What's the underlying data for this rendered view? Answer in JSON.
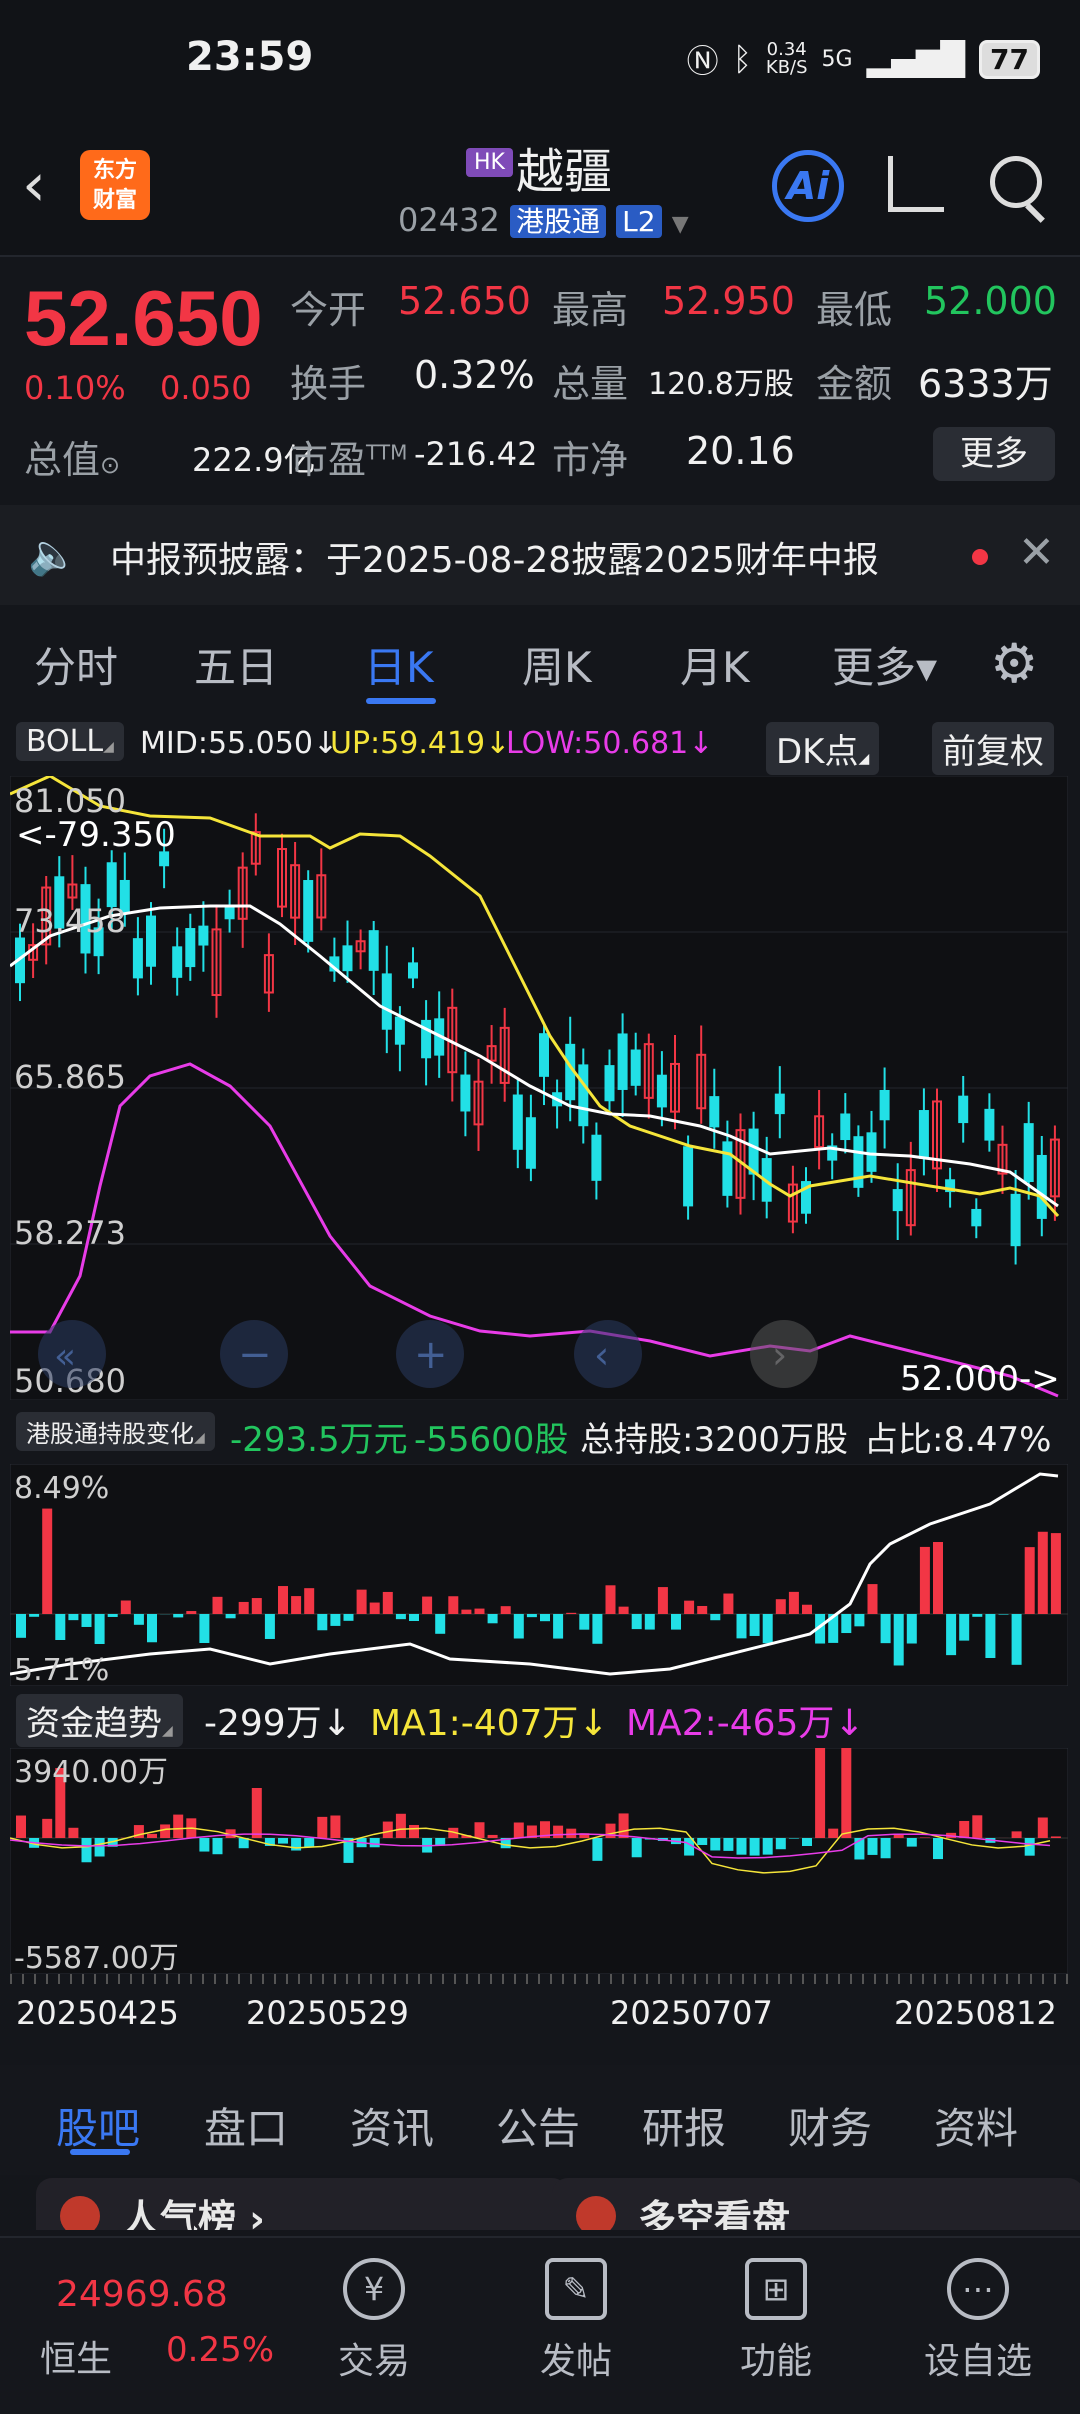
{
  "status_bar": {
    "time": "23:59",
    "net_speed": "0.34",
    "net_unit": "KB/S",
    "signal": "5G",
    "battery": "77"
  },
  "header": {
    "logo_line1": "东方",
    "logo_line2": "财富",
    "market_badge": "HK",
    "name": "越疆",
    "code": "02432",
    "connect_tag": "港股通",
    "level_tag": "L2",
    "ai_label": "Ai"
  },
  "quote": {
    "price": "52.650",
    "change_pct": "0.10%",
    "change_amt": "0.050",
    "open_label": "今开",
    "open": "52.650",
    "high_label": "最高",
    "high": "52.950",
    "low_label": "最低",
    "low": "52.000",
    "turnover_label": "换手",
    "turnover": "0.32%",
    "volume_label": "总量",
    "volume": "120.8万股",
    "amount_label": "金额",
    "amount": "6333万",
    "mcap_label": "总值",
    "mcap": "222.9亿",
    "pe_label": "市盈",
    "pe_sup": "TTM",
    "pe": "-216.42",
    "pb_label": "市净",
    "pb": "20.16",
    "more": "更多"
  },
  "notice": {
    "text": "中报预披露：于2025-08-28披露2025财年中报"
  },
  "ktabs": [
    "分时",
    "五日",
    "日K",
    "周K",
    "月K",
    "更多▾"
  ],
  "boll": {
    "name": "BOLL",
    "mid": "MID:55.050↓",
    "up": "UP:59.419↓",
    "low": "LOW:50.681↓",
    "dk": "DK点",
    "adj": "前复权"
  },
  "main_chart": {
    "y_labels": [
      "81.050",
      "73.458",
      "65.865",
      "58.273",
      "50.680"
    ],
    "max_marker": "<-79.350",
    "min_marker": "52.000->"
  },
  "hold": {
    "name": "港股通持股变化",
    "chg_amount": "-293.5万元",
    "chg_shares": "-55600股",
    "total": "总持股:3200万股",
    "ratio": "占比:8.47%",
    "y_top": "8.49%",
    "y_bottom": "5.71%"
  },
  "fund": {
    "name": "资金趋势",
    "value": "-299万↓",
    "ma1": "MA1:-407万↓",
    "ma2": "MA2:-465万↓",
    "y_top": "3940.00万",
    "y_bottom": "-5587.00万"
  },
  "x_dates": [
    "20250425",
    "20250529",
    "20250707",
    "20250812"
  ],
  "subtabs": [
    "股吧",
    "盘口",
    "资讯",
    "公告",
    "研报",
    "财务",
    "资料"
  ],
  "cards": [
    "人气榜 ›",
    "多空看盘"
  ],
  "bottom_nav": {
    "index_value": "24969.68",
    "index_name": "恒生",
    "index_change": "0.25%",
    "items": [
      "交易",
      "发帖",
      "功能",
      "设自选"
    ]
  },
  "colors": {
    "up": "#f23645",
    "down": "#22e0e6",
    "boll_up": "#f5e53a",
    "boll_mid": "#ffffff",
    "boll_low": "#e83ce8",
    "accent": "#3a78f2"
  }
}
